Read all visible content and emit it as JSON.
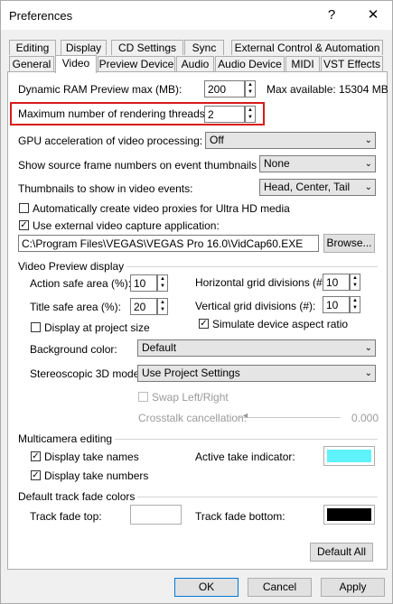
{
  "window": {
    "title": "Preferences",
    "help_glyph": "?",
    "close_glyph": "✕"
  },
  "tabs": {
    "row1": [
      "Editing",
      "Display",
      "CD Settings",
      "Sync",
      "External Control & Automation"
    ],
    "row2": [
      "General",
      "Video",
      "Preview Device",
      "Audio",
      "Audio Device",
      "MIDI",
      "VST Effects"
    ],
    "active": "Video"
  },
  "video": {
    "dynamic_ram": {
      "label": "Dynamic RAM Preview max (MB):",
      "value": "200",
      "max_available": "Max available: 15304 MB"
    },
    "threads": {
      "label": "Maximum number of rendering threads:",
      "value": "2"
    },
    "gpu": {
      "label": "GPU acceleration of video processing:",
      "value": "Off"
    },
    "source_frames": {
      "label": "Show source frame numbers on event thumbnails as:",
      "value": "None"
    },
    "thumbnails": {
      "label": "Thumbnails to show in video events:",
      "value": "Head, Center, Tail"
    },
    "auto_proxies": {
      "label": "Automatically create video proxies for Ultra HD media",
      "checked": false
    },
    "external_capture": {
      "label": "Use external video capture application:",
      "checked": true,
      "path": "C:\\Program Files\\VEGAS\\VEGAS Pro 16.0\\VidCap60.EXE",
      "browse_label": "Browse..."
    }
  },
  "preview_display": {
    "group_label": "Video Preview display",
    "action_safe": {
      "label": "Action safe area (%):",
      "value": "10"
    },
    "title_safe": {
      "label": "Title safe area (%):",
      "value": "20"
    },
    "h_grid": {
      "label": "Horizontal grid divisions (#):",
      "value": "10"
    },
    "v_grid": {
      "label": "Vertical grid divisions (#):",
      "value": "10"
    },
    "project_size": {
      "label": "Display at project size",
      "checked": false
    },
    "aspect_ratio": {
      "label": "Simulate device aspect ratio",
      "checked": true
    },
    "background": {
      "label": "Background color:",
      "value": "Default"
    },
    "stereo": {
      "label": "Stereoscopic 3D mode:",
      "value": "Use Project Settings"
    },
    "swap": {
      "label": "Swap Left/Right",
      "checked": false
    },
    "crosstalk": {
      "label": "Crosstalk cancellation:",
      "value": "0.000"
    }
  },
  "multicam": {
    "group_label": "Multicamera editing",
    "take_names": {
      "label": "Display take names",
      "checked": true
    },
    "take_numbers": {
      "label": "Display take numbers",
      "checked": true
    },
    "indicator": {
      "label": "Active take indicator:",
      "color": "#5ef3fa"
    }
  },
  "fade": {
    "group_label": "Default track fade colors",
    "top": {
      "label": "Track fade top:",
      "color": "#ffffff"
    },
    "bottom": {
      "label": "Track fade bottom:",
      "color": "#000000"
    }
  },
  "buttons": {
    "default_all": "Default All",
    "ok": "OK",
    "cancel": "Cancel",
    "apply": "Apply"
  },
  "glyphs": {
    "check": "✓",
    "spin_up": "▲",
    "spin_down": "▼",
    "dropdown": "⌄"
  }
}
